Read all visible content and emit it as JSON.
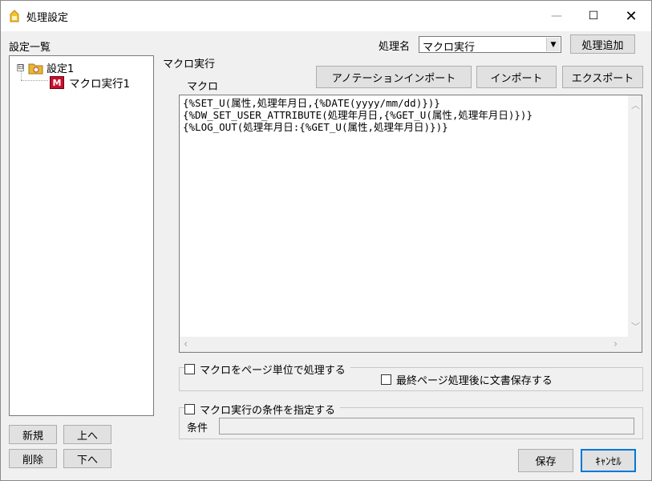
{
  "window": {
    "title": "処理設定",
    "minimize_glyph": "—",
    "maximize_glyph": "☐",
    "close_glyph": "✕"
  },
  "left_panel": {
    "list_label": "設定一覧",
    "tree": [
      {
        "label": "設定1",
        "expander": "⊟",
        "icon": "folder-icon"
      },
      {
        "label": "マクロ実行1",
        "icon": "macro-icon",
        "icon_letter": "M"
      }
    ],
    "buttons": {
      "new": "新規",
      "up": "上へ",
      "delete": "削除",
      "down": "下へ"
    }
  },
  "header": {
    "process_name_label": "処理名",
    "process_name_value": "マクロ実行",
    "add_process": "処理追加"
  },
  "section": {
    "title": "マクロ実行",
    "macro_label": "マクロ",
    "annotation_import": "アノテーションインポート",
    "import": "インポート",
    "export": "エクスポート",
    "macro_lines": [
      "{%SET_U(属性,処理年月日,{%DATE(yyyy/mm/dd)})}",
      "{%DW_SET_USER_ATTRIBUTE(処理年月日,{%GET_U(属性,処理年月日)})}",
      "{%LOG_OUT(処理年月日:{%GET_U(属性,処理年月日)})}"
    ],
    "page_unit_checkbox": "マクロをページ単位で処理する",
    "save_after_last_page": "最終ページ処理後に文書保存する",
    "condition_checkbox": "マクロ実行の条件を指定する",
    "condition_label": "条件",
    "condition_value": ""
  },
  "footer": {
    "save": "保存",
    "cancel": "ｷｬﾝｾﾙ"
  },
  "colors": {
    "folder": "#e8b830",
    "macro_icon": "#c8102e",
    "focus_border": "#0078d7"
  }
}
